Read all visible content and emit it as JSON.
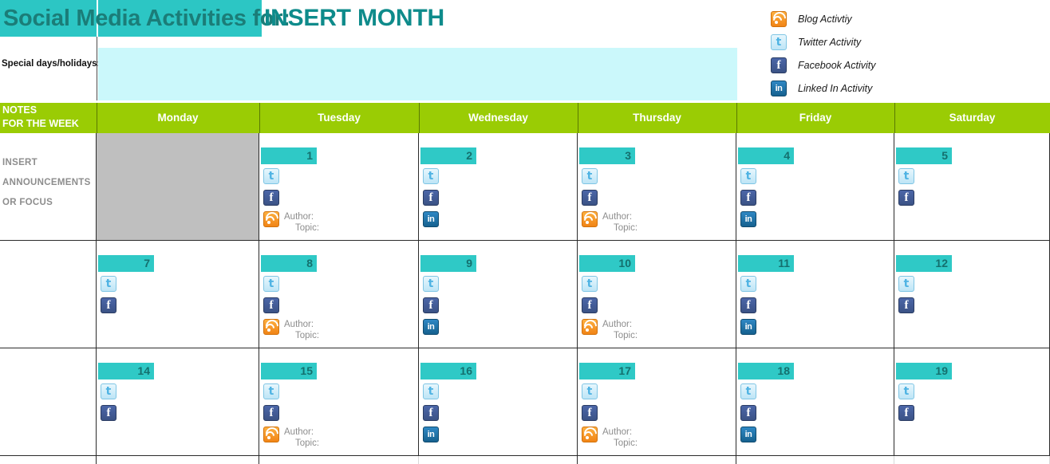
{
  "header": {
    "title_prefix": "Social Media Activities for:",
    "month_placeholder": "INSERT MONTH",
    "special_days_label": "Special days/holidays:",
    "special_days_value": ""
  },
  "legend": {
    "items": [
      {
        "icon": "rss-icon",
        "label": "Blog Activtiy"
      },
      {
        "icon": "twitter-icon",
        "label": "Twitter Activity"
      },
      {
        "icon": "facebook-icon",
        "label": "Facebook Activity"
      },
      {
        "icon": "linkedin-icon",
        "label": "Linked In Activity"
      }
    ]
  },
  "colors": {
    "teal": "#2cc6c4",
    "teal_dark_text": "#1b7d78",
    "month_text": "#0e8b8b",
    "green": "#9acc04",
    "cyan_field": "#cbf8fb",
    "gray_blank": "#bfbfbf",
    "date_badge": "#2fc9c6",
    "date_badge_text": "#14706e",
    "muted_text": "#8d8d8d"
  },
  "notes_column": {
    "header_line1": "NOTES",
    "header_line2": "FOR THE WEEK",
    "placeholder_line1": "INSERT",
    "placeholder_line2": "ANNOUNCEMENTS",
    "placeholder_line3": "OR FOCUS"
  },
  "day_headers": [
    "Monday",
    "Tuesday",
    "Wednesday",
    "Thursday",
    "Friday",
    "Saturday"
  ],
  "blog_fields": {
    "author_label": "Author:",
    "topic_label": "Topic:"
  },
  "weeks": [
    {
      "notes": "INSERT ANNOUNCEMENTS OR FOCUS",
      "days": [
        {
          "date": "",
          "blank": true,
          "icons": []
        },
        {
          "date": "1",
          "blank": false,
          "icons": [
            "twitter-icon",
            "facebook-icon",
            "rss-icon"
          ]
        },
        {
          "date": "2",
          "blank": false,
          "icons": [
            "twitter-icon",
            "facebook-icon",
            "linkedin-icon"
          ]
        },
        {
          "date": "3",
          "blank": false,
          "icons": [
            "twitter-icon",
            "facebook-icon",
            "rss-icon"
          ]
        },
        {
          "date": "4",
          "blank": false,
          "icons": [
            "twitter-icon",
            "facebook-icon",
            "linkedin-icon"
          ]
        },
        {
          "date": "5",
          "blank": false,
          "icons": [
            "twitter-icon",
            "facebook-icon"
          ]
        }
      ]
    },
    {
      "notes": "",
      "days": [
        {
          "date": "7",
          "blank": false,
          "icons": [
            "twitter-icon",
            "facebook-icon"
          ]
        },
        {
          "date": "8",
          "blank": false,
          "icons": [
            "twitter-icon",
            "facebook-icon",
            "rss-icon"
          ]
        },
        {
          "date": "9",
          "blank": false,
          "icons": [
            "twitter-icon",
            "facebook-icon",
            "linkedin-icon"
          ]
        },
        {
          "date": "10",
          "blank": false,
          "icons": [
            "twitter-icon",
            "facebook-icon",
            "rss-icon"
          ]
        },
        {
          "date": "11",
          "blank": false,
          "icons": [
            "twitter-icon",
            "facebook-icon",
            "linkedin-icon"
          ]
        },
        {
          "date": "12",
          "blank": false,
          "icons": [
            "twitter-icon",
            "facebook-icon"
          ]
        }
      ]
    },
    {
      "notes": "",
      "days": [
        {
          "date": "14",
          "blank": false,
          "icons": [
            "twitter-icon",
            "facebook-icon"
          ]
        },
        {
          "date": "15",
          "blank": false,
          "icons": [
            "twitter-icon",
            "facebook-icon",
            "rss-icon"
          ]
        },
        {
          "date": "16",
          "blank": false,
          "icons": [
            "twitter-icon",
            "facebook-icon",
            "linkedin-icon"
          ]
        },
        {
          "date": "17",
          "blank": false,
          "icons": [
            "twitter-icon",
            "facebook-icon",
            "rss-icon"
          ]
        },
        {
          "date": "18",
          "blank": false,
          "icons": [
            "twitter-icon",
            "facebook-icon",
            "linkedin-icon"
          ]
        },
        {
          "date": "19",
          "blank": false,
          "icons": [
            "twitter-icon",
            "facebook-icon"
          ]
        }
      ]
    }
  ]
}
